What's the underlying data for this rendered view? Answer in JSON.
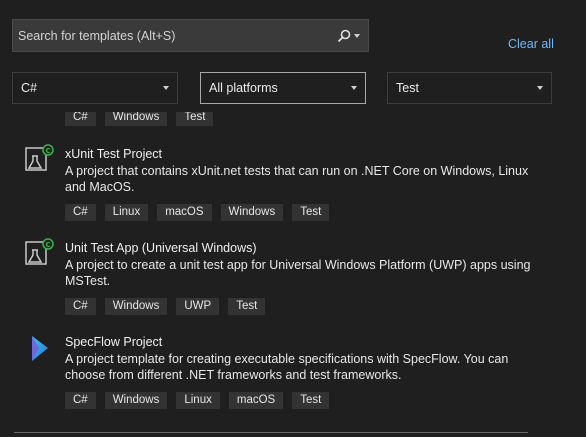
{
  "search": {
    "placeholder": "Search for templates (Alt+S)"
  },
  "clear_all": "Clear all",
  "filters": {
    "language": "C#",
    "platform": "All platforms",
    "project_type": "Test"
  },
  "partial_tags": [
    "C#",
    "Windows",
    "Test"
  ],
  "templates": [
    {
      "title": "xUnit Test Project",
      "description": "A project that contains xUnit.net tests that can run on .NET Core on Windows, Linux and MacOS.",
      "tags": [
        "C#",
        "Linux",
        "macOS",
        "Windows",
        "Test"
      ],
      "icon": "test-flask-icon"
    },
    {
      "title": "Unit Test App (Universal Windows)",
      "description": "A project to create a unit test app for Universal Windows Platform (UWP) apps using MSTest.",
      "tags": [
        "C#",
        "Windows",
        "UWP",
        "Test"
      ],
      "icon": "test-flask-icon"
    },
    {
      "title": "SpecFlow Project",
      "description": "A project template for creating executable specifications with SpecFlow. You can choose from different .NET frameworks and test frameworks.",
      "tags": [
        "C#",
        "Windows",
        "Linux",
        "macOS",
        "Test"
      ],
      "icon": "specflow-icon"
    }
  ],
  "colors": {
    "background": "#1f1f1f",
    "link": "#6fb7ff",
    "tag_bg": "#333333"
  }
}
